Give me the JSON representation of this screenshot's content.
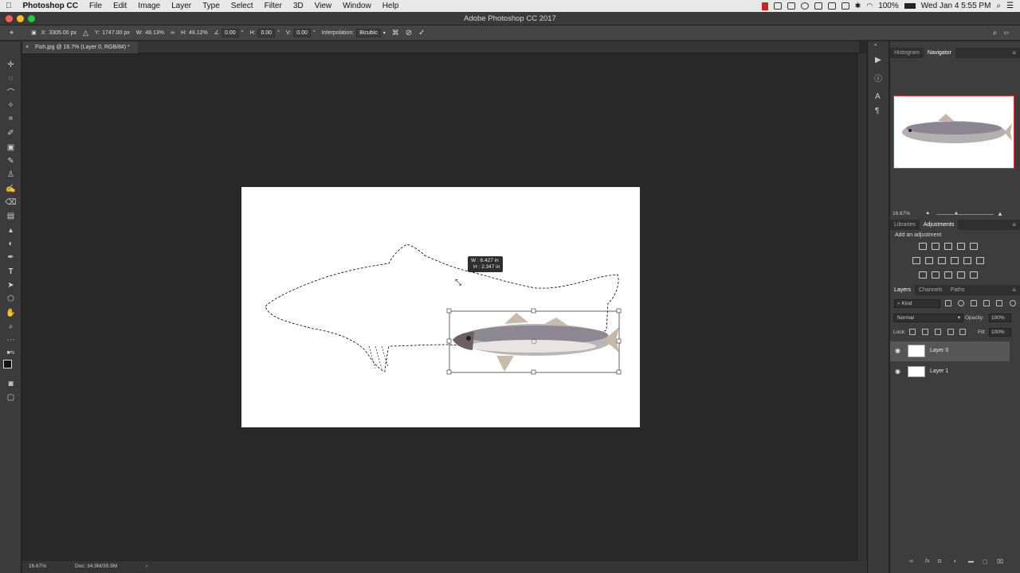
{
  "menubar": {
    "apple_icon": "apple-icon",
    "app_name": "Photoshop CC",
    "items": [
      "File",
      "Edit",
      "Image",
      "Layer",
      "Type",
      "Select",
      "Filter",
      "3D",
      "View",
      "Window",
      "Help"
    ],
    "battery": "100%",
    "clock": "Wed Jan 4  5:55 PM"
  },
  "window": {
    "title": "Adobe Photoshop CC 2017"
  },
  "options": {
    "x_label": "X:",
    "x_value": "3305.00 px",
    "y_label": "Y:",
    "y_value": "1747.00 px",
    "w_label": "W:",
    "w_value": "48.13%",
    "h_label": "H:",
    "h_value": "48.12%",
    "angle_value": "0.00",
    "angle_unit": "°",
    "hskew_label": "H:",
    "hskew_value": "0.00",
    "vskew_label": "V:",
    "vskew_value": "0.00",
    "interp_label": "Interpolation:",
    "interp_value": "Bicubic"
  },
  "document": {
    "tab_title": "Fish.jpg @ 16.7% (Layer 0, RGB/8#) *",
    "transform_tip_w": "W : 6.427 in",
    "transform_tip_h": "H : 2.347 in"
  },
  "status": {
    "zoom": "16.67%",
    "doc": "Doc: 34.9M/39.9M"
  },
  "panels": {
    "top_tabs": [
      "Histogram",
      "Navigator"
    ],
    "nav_zoom": "16.67%",
    "mid_tabs": [
      "Libraries",
      "Adjustments"
    ],
    "add_adjustment": "Add an adjustment",
    "layer_tabs": [
      "Layers",
      "Channels",
      "Paths"
    ],
    "kind_filter": "Kind",
    "blend_mode": "Normal",
    "opacity_label": "Opacity:",
    "opacity_value": "100%",
    "lock_label": "Lock:",
    "fill_label": "Fill:",
    "fill_value": "100%",
    "layers": [
      {
        "name": "Layer 0",
        "selected": true
      },
      {
        "name": "Layer 1",
        "selected": false
      }
    ]
  },
  "colors": {
    "accent_red": "#e03030",
    "panel_bg": "#3d3d3d",
    "canvas_bg": "#282828"
  }
}
